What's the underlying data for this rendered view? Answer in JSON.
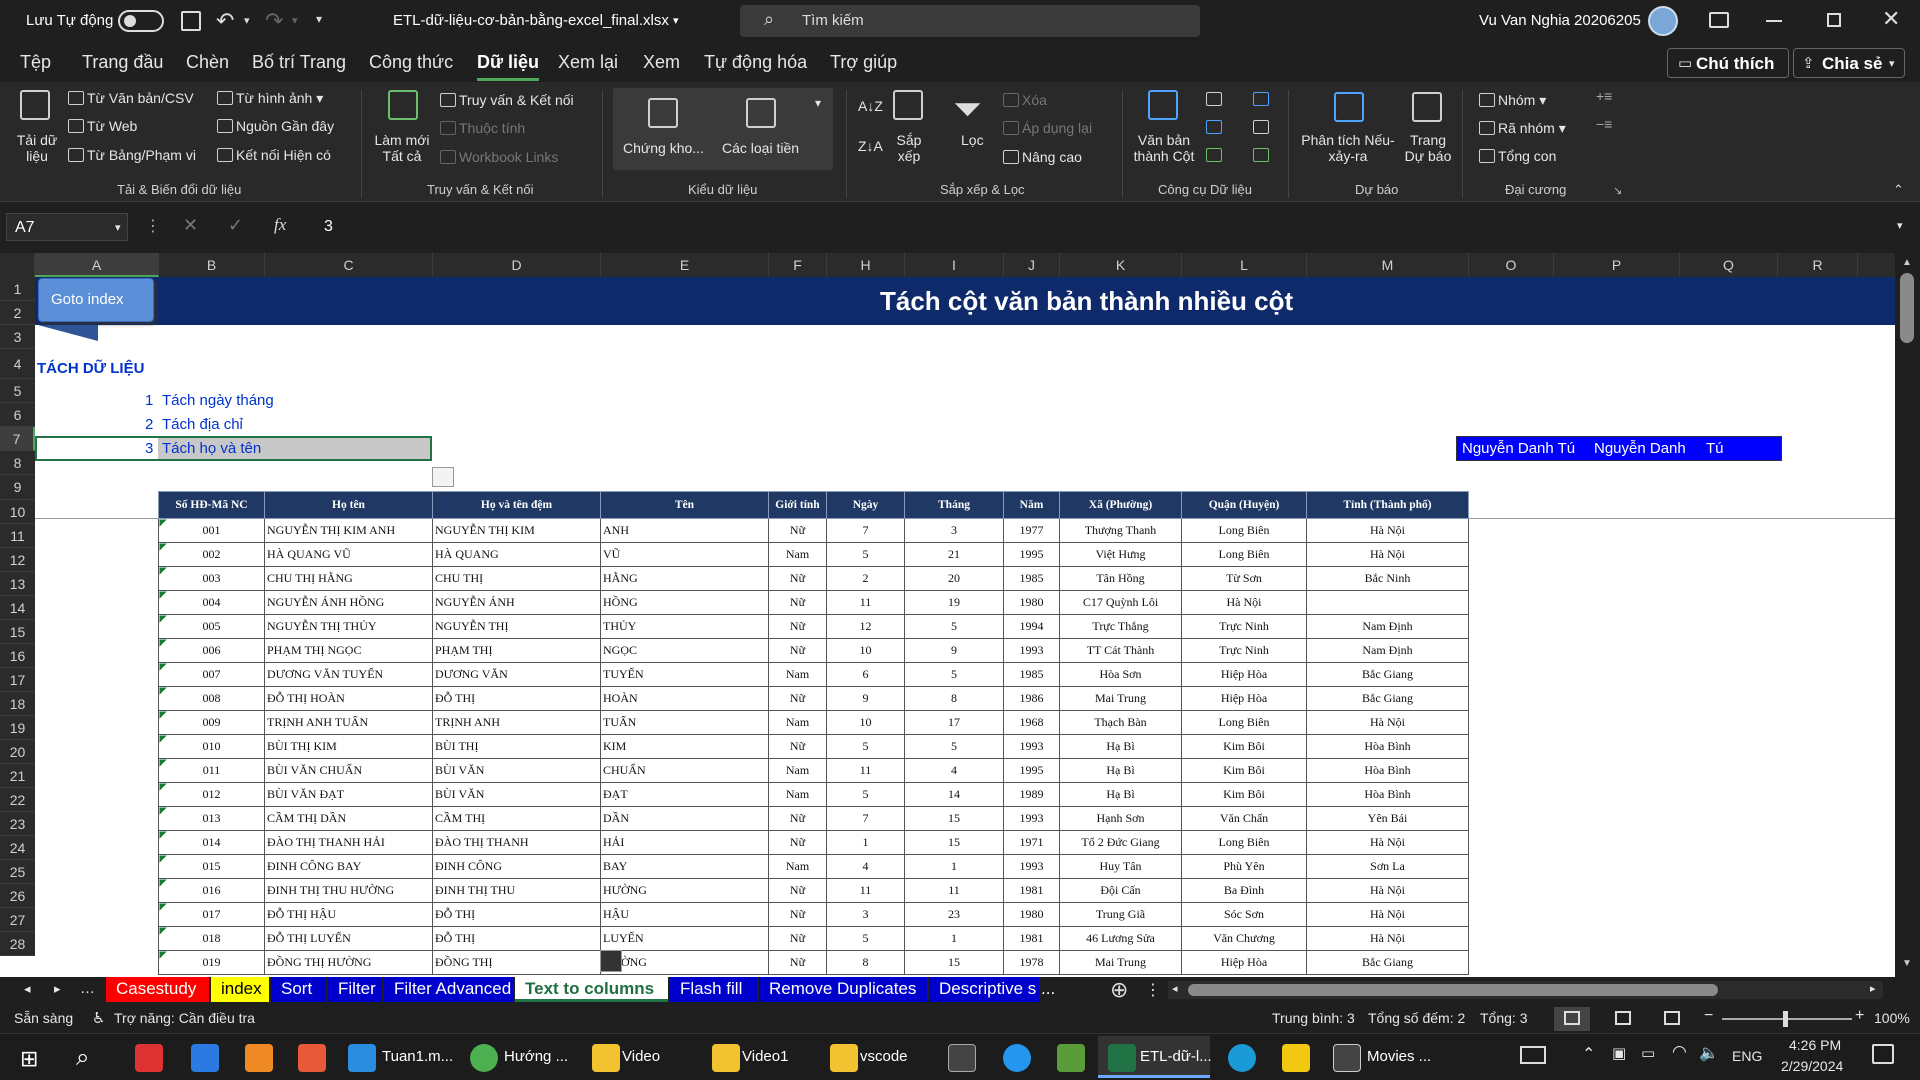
{
  "titlebar": {
    "autosave": "Lưu Tự động",
    "filename": "ETL-dữ-liệu-cơ-bản-bằng-excel_final.xlsx",
    "search_placeholder": "Tìm kiếm",
    "user": "Vu Van Nghia 20206205"
  },
  "menu": {
    "items": [
      "Tệp",
      "Trang đầu",
      "Chèn",
      "Bố trí Trang",
      "Công thức",
      "Dữ liệu",
      "Xem lại",
      "Xem",
      "Tự động hóa",
      "Trợ giúp"
    ],
    "active": "Dữ liệu",
    "comment": "Chú thích",
    "share": "Chia sẻ"
  },
  "ribbon": {
    "get_data": "Tải dữ liệu",
    "from_text": "Từ Văn bản/CSV",
    "from_web": "Từ Web",
    "from_table": "Từ Bảng/Phạm vi",
    "from_picture": "Từ hình ảnh",
    "recent_sources": "Nguồn Gần đây",
    "existing_conn": "Kết nối Hiện có",
    "grp_transform": "Tải & Biến đổi dữ liệu",
    "refresh_all": "Làm mới Tất cả",
    "queries_conn": "Truy vấn & Kết nối",
    "properties": "Thuộc tính",
    "workbook_links": "Workbook Links",
    "grp_queries": "Truy vấn & Kết nối",
    "stocks": "Chứng kho...",
    "data_types": "Các loại tiền",
    "grp_types": "Kiểu dữ liệu",
    "sort": "Sắp xếp",
    "filter": "Lọc",
    "clear": "Xóa",
    "reapply": "Áp dụng lại",
    "advanced": "Nâng cao",
    "grp_sort": "Sắp xếp & Lọc",
    "text_to_columns": "Văn bản thành Cột",
    "grp_tools": "Công cụ Dữ liệu",
    "whatif": "Phân tích Nếu-xảy-ra",
    "forecast_sheet": "Trang Dự báo",
    "grp_forecast": "Dự báo",
    "group": "Nhóm",
    "ungroup": "Rã nhóm",
    "subtotal": "Tổng con",
    "grp_outline": "Đại cương"
  },
  "formula_bar": {
    "name_box": "A7",
    "value": "3",
    "fx": "fx"
  },
  "columns": [
    "A",
    "B",
    "C",
    "D",
    "E",
    "F",
    "H",
    "I",
    "J",
    "K",
    "L",
    "M",
    "O",
    "P",
    "Q",
    "R"
  ],
  "rows": [
    "1",
    "2",
    "3",
    "4",
    "5",
    "6",
    "7",
    "8",
    "9",
    "10",
    "11",
    "12",
    "13",
    "14",
    "15",
    "16",
    "17",
    "18",
    "19",
    "20",
    "21",
    "22",
    "23",
    "24",
    "25",
    "26",
    "27",
    "28"
  ],
  "sheet": {
    "goto_button": "Goto index",
    "banner_title": "Tách cột văn bản thành nhiều cột",
    "section_title": "TÁCH DỮ LIỆU",
    "list": [
      {
        "n": "1",
        "t": "Tách ngày tháng"
      },
      {
        "n": "2",
        "t": "Tách địa chỉ"
      },
      {
        "n": "3",
        "t": "Tách họ và tên"
      }
    ],
    "name_box_cells": [
      "Nguyễn Danh Tú",
      "Nguyễn Danh",
      "Tú"
    ],
    "headers": [
      "Số HĐ-Mã NC",
      "Họ tên",
      "Họ và tên đệm",
      "Tên",
      "Giới tính",
      "Ngày",
      "Tháng",
      "Năm",
      "Xã (Phường)",
      "Quận (Huyện)",
      "Tỉnh (Thành phố)"
    ],
    "rows": [
      [
        "001",
        "NGUYỄN THỊ KIM ANH",
        "NGUYỄN THỊ KIM",
        "ANH",
        "Nữ",
        "7",
        "3",
        "1977",
        "Thượng Thanh",
        "Long Biên",
        "Hà Nội"
      ],
      [
        "002",
        "HÀ QUANG VŨ",
        "HÀ QUANG",
        "VŨ",
        "Nam",
        "5",
        "21",
        "1995",
        "Việt Hưng",
        "Long Biên",
        "Hà Nội"
      ],
      [
        "003",
        "CHU THỊ HẰNG",
        "CHU THỊ",
        "HẰNG",
        "Nữ",
        "2",
        "20",
        "1985",
        "Tân Hồng",
        "Từ Sơn",
        "Bắc Ninh"
      ],
      [
        "004",
        "NGUYỄN ÁNH HỒNG",
        "NGUYỄN ÁNH",
        "HỒNG",
        "Nữ",
        "11",
        "19",
        "1980",
        "C17 Quỳnh Lôi",
        "Hà Nội",
        ""
      ],
      [
        "005",
        "NGUYỄN THỊ THỦY",
        "NGUYỄN THỊ",
        "THỦY",
        "Nữ",
        "12",
        "5",
        "1994",
        "Trực Thắng",
        "Trực Ninh",
        "Nam Định"
      ],
      [
        "006",
        "PHẠM THỊ NGỌC",
        "PHẠM THỊ",
        "NGỌC",
        "Nữ",
        "10",
        "9",
        "1993",
        "TT Cát Thành",
        "Trực Ninh",
        "Nam Định"
      ],
      [
        "007",
        "DƯƠNG VĂN TUYẾN",
        "DƯƠNG VĂN",
        "TUYẾN",
        "Nam",
        "6",
        "5",
        "1985",
        "Hòa Sơn",
        "Hiệp Hòa",
        "Bắc Giang"
      ],
      [
        "008",
        "ĐỖ THỊ HOÀN",
        "ĐỖ THỊ",
        "HOÀN",
        "Nữ",
        "9",
        "8",
        "1986",
        "Mai Trung",
        "Hiệp Hòa",
        "Bắc Giang"
      ],
      [
        "009",
        "TRỊNH ANH TUẤN",
        "TRỊNH ANH",
        "TUẤN",
        "Nam",
        "10",
        "17",
        "1968",
        "Thạch Bàn",
        "Long Biên",
        "Hà Nội"
      ],
      [
        "010",
        "BÙI THỊ KIM",
        "BÙI THỊ",
        "KIM",
        "Nữ",
        "5",
        "5",
        "1993",
        "Hạ Bì",
        "Kim Bôi",
        "Hòa Bình"
      ],
      [
        "011",
        "BÙI VĂN CHUẨN",
        "BÙI VĂN",
        "CHUẨN",
        "Nam",
        "11",
        "4",
        "1995",
        "Hạ Bì",
        "Kim Bôi",
        "Hòa Bình"
      ],
      [
        "012",
        "BÙI VĂN ĐẠT",
        "BÙI VĂN",
        "ĐẠT",
        "Nam",
        "5",
        "14",
        "1989",
        "Hạ Bì",
        "Kim Bôi",
        "Hòa Bình"
      ],
      [
        "013",
        "CẦM THỊ DẦN",
        "CẦM THỊ",
        "DẦN",
        "Nữ",
        "7",
        "15",
        "1993",
        "Hạnh Sơn",
        "Văn Chấn",
        "Yên Bái"
      ],
      [
        "014",
        "ĐÀO THỊ THANH HẢI",
        "ĐÀO THỊ THANH",
        "HẢI",
        "Nữ",
        "1",
        "15",
        "1971",
        "Tổ 2 Đức Giang",
        "Long Biên",
        "Hà Nội"
      ],
      [
        "015",
        "ĐINH CÔNG BAY",
        "ĐINH CÔNG",
        "BAY",
        "Nam",
        "4",
        "1",
        "1993",
        "Huy Tân",
        "Phù Yên",
        "Sơn La"
      ],
      [
        "016",
        "ĐINH THỊ THU HƯỜNG",
        "ĐINH THỊ THU",
        "HƯỜNG",
        "Nữ",
        "11",
        "11",
        "1981",
        "Đội Cấn",
        "Ba Đình",
        "Hà Nội"
      ],
      [
        "017",
        "ĐỖ THỊ HẬU",
        "ĐỖ THỊ",
        "HẬU",
        "Nữ",
        "3",
        "23",
        "1980",
        "Trung Giã",
        "Sóc Sơn",
        "Hà Nội"
      ],
      [
        "018",
        "ĐỖ THỊ LUYẾN",
        "ĐỖ THỊ",
        "LUYẾN",
        "Nữ",
        "5",
        "1",
        "1981",
        "46 Lương Sửa",
        "Văn Chương",
        "Hà Nội"
      ],
      [
        "019",
        "ĐỒNG THỊ HƯỜNG",
        "ĐỒNG THỊ",
        "HƯỜNG",
        "Nữ",
        "8",
        "15",
        "1978",
        "Mai Trung",
        "Hiệp Hòa",
        "Bắc Giang"
      ]
    ]
  },
  "sheet_tabs": [
    {
      "label": "Casestudy",
      "bg": "#ff0000",
      "fg": "#ffffff"
    },
    {
      "label": "index",
      "bg": "#ffff00",
      "fg": "#000000"
    },
    {
      "label": "Sort",
      "bg": "#0000cc",
      "fg": "#ffffff"
    },
    {
      "label": "Filter",
      "bg": "#0000cc",
      "fg": "#ffffff"
    },
    {
      "label": "Filter Advanced",
      "bg": "#0000cc",
      "fg": "#ffffff"
    },
    {
      "label": "Text to columns",
      "bg": "#ffffff",
      "fg": "#1f6f3f"
    },
    {
      "label": "Flash fill",
      "bg": "#0000cc",
      "fg": "#ffffff"
    },
    {
      "label": "Remove Duplicates",
      "bg": "#0000cc",
      "fg": "#ffffff"
    },
    {
      "label": "Descriptive s ...",
      "bg": "#0000cc",
      "fg": "#ffffff"
    }
  ],
  "status": {
    "ready": "Sẵn sàng",
    "accessibility": "Trợ năng: Cần điều tra",
    "average": "Trung bình: 3",
    "count": "Tổng số đếm: 2",
    "sum": "Tổng: 3",
    "zoom": "100%"
  },
  "taskbar": {
    "items": [
      "Tuan1.m...",
      "Hướng ...",
      "Video",
      "Video1",
      "vscode",
      "ETL-dữ-l...",
      "Movies ..."
    ],
    "lang": "ENG",
    "time": "4:26 PM",
    "date": "2/29/2024"
  },
  "colors": {
    "banner": "#0f2a6b",
    "header_bg": "#1f3864",
    "accent": "#4ea85a",
    "link_blue": "#0033cc",
    "name_box_bg": "#0000ff"
  }
}
